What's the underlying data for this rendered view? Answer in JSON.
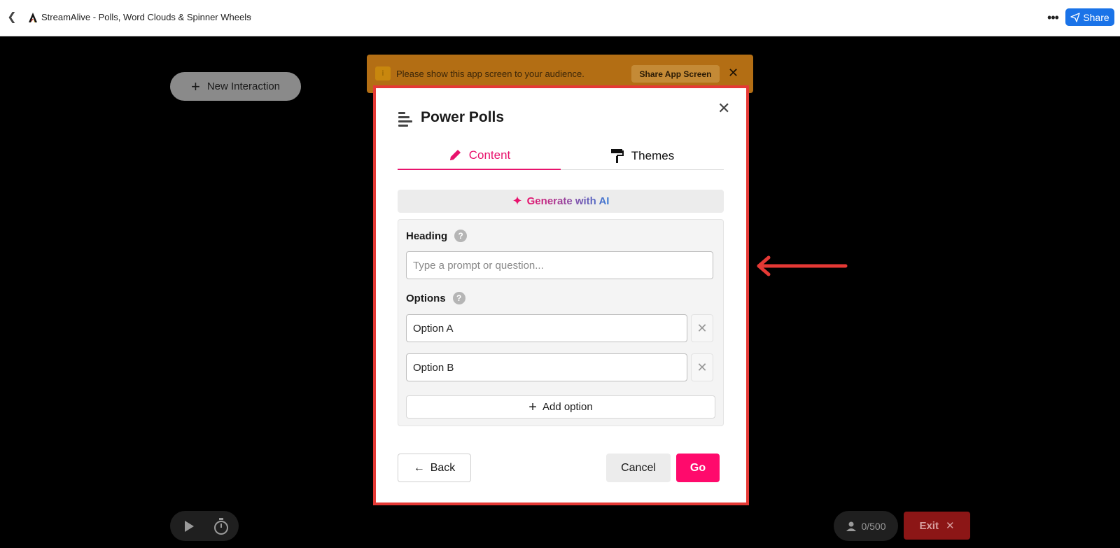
{
  "header": {
    "app_title": "StreamAlive - Polls, Word Clouds & Spinner Wheels",
    "share_label": "Share",
    "more_label": "•••"
  },
  "stage": {
    "new_interaction_label": "New Interaction"
  },
  "banner": {
    "message": "Please show this app screen to your audience.",
    "share_button_label": "Share App Screen"
  },
  "modal": {
    "title": "Power Polls",
    "tabs": [
      {
        "label": "Content",
        "active": true
      },
      {
        "label": "Themes",
        "active": false
      }
    ],
    "generate_ai_label": "Generate with AI",
    "heading": {
      "label": "Heading",
      "placeholder": "Type a prompt or question...",
      "value": ""
    },
    "options": {
      "label": "Options",
      "items": [
        {
          "value": "Option A"
        },
        {
          "value": "Option B"
        }
      ],
      "add_label": "Add option"
    },
    "buttons": {
      "back_label": "Back",
      "cancel_label": "Cancel",
      "go_label": "Go"
    }
  },
  "footer": {
    "participants": "0/500",
    "exit_label": "Exit"
  },
  "colors": {
    "accent": "#e8136d",
    "go_button": "#ff0a6c",
    "share_button": "#1a73e8",
    "highlight_frame": "#e53935",
    "banner": "#b36e14",
    "exit_button": "#8c1616"
  }
}
